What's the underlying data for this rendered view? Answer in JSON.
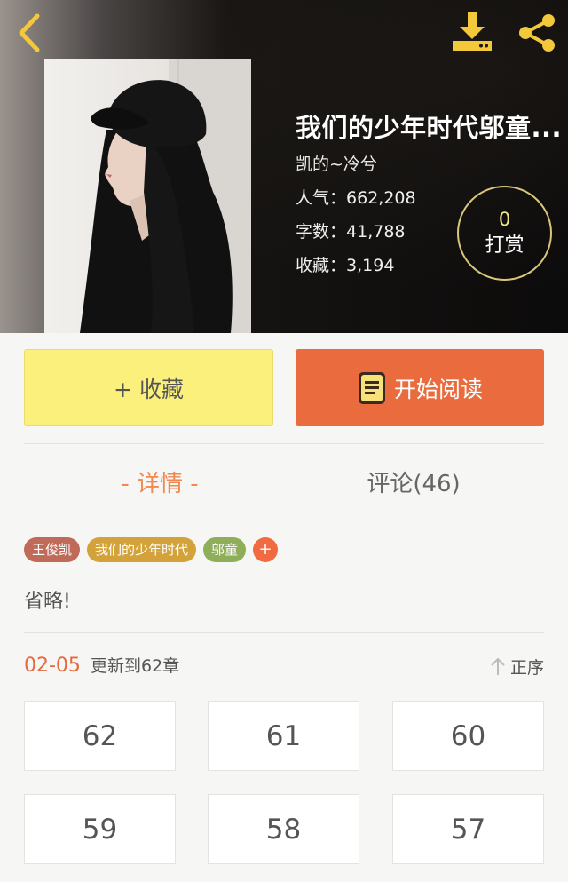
{
  "header": {
    "book_title": "我们的少年时代邬童...",
    "author": "凯的~冷兮",
    "stats": [
      {
        "label": "人气：",
        "value": "662,208"
      },
      {
        "label": "字数：",
        "value": "41,788"
      },
      {
        "label": "收藏：",
        "value": "3,194"
      }
    ],
    "tip_count": "0",
    "tip_label": "打赏",
    "icons": {
      "back": "chevron-left-icon",
      "download": "download-icon",
      "share": "share-icon"
    },
    "accent_color": "#f3c83a"
  },
  "actions": {
    "collect_label": "+ 收藏",
    "read_label": "开始阅读"
  },
  "tabs": {
    "details": "- 详情 -",
    "comments": "评论(46)"
  },
  "tags": [
    {
      "label": "王俊凯",
      "color": "#c06a5a"
    },
    {
      "label": "我们的少年时代",
      "color": "#d4a23a"
    },
    {
      "label": "邬童",
      "color": "#8fae5a"
    }
  ],
  "summary": "省略!",
  "update": {
    "date": "02-05",
    "text": "更新到62章",
    "sort_label": "正序"
  },
  "chapters": [
    "62",
    "61",
    "60",
    "59",
    "58",
    "57"
  ],
  "colors": {
    "collect_bg": "#fbf07c",
    "read_bg": "#ea6b3d",
    "active_tab": "#f0884f",
    "date": "#e56a3d"
  }
}
